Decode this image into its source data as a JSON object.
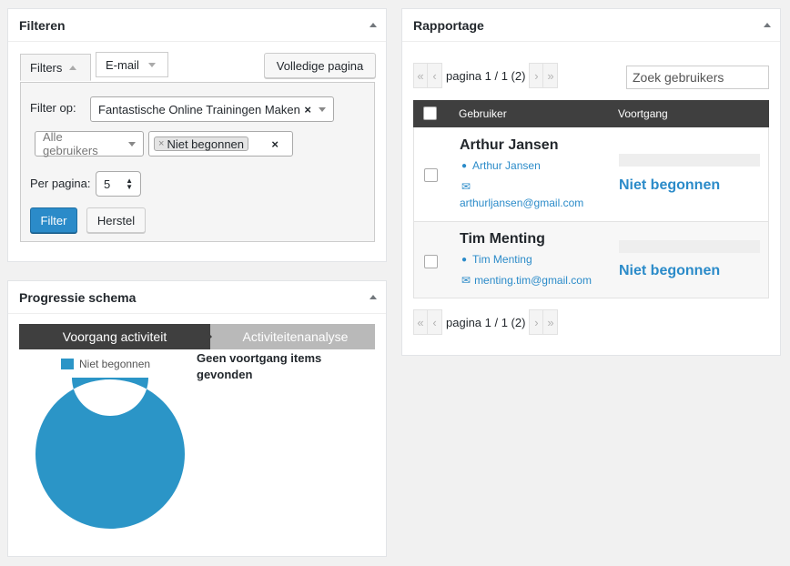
{
  "filter_box": {
    "title": "Filteren",
    "tab_filters": "Filters",
    "tab_email": "E-mail",
    "full_page_button": "Volledige pagina",
    "filter_on_label": "Filter op:",
    "course_select": "Fantastische Online Trainingen Maken",
    "users_select": "Alle gebruikers",
    "status_tag": "Niet begonnen",
    "per_page_label": "Per pagina:",
    "per_page_value": "5",
    "filter_button": "Filter",
    "reset_button": "Herstel"
  },
  "progress_box": {
    "title": "Progressie schema",
    "step_active": "Voorgang activiteit",
    "step_next": "Activiteitenanalyse",
    "legend_label": "Niet begonnen",
    "no_items_text": "Geen voortgang items gevonden",
    "accent_color": "#2b95c7"
  },
  "chart_data": {
    "type": "pie",
    "categories": [
      "Niet begonnen"
    ],
    "values": [
      100
    ],
    "donut": true
  },
  "report_box": {
    "title": "Rapportage",
    "pagination_text": "pagina 1 / 1 (2)",
    "search_placeholder": "Zoek gebruikers",
    "col_user": "Gebruiker",
    "col_progress": "Voortgang",
    "rows": [
      {
        "name": "Arthur Jansen",
        "username": "Arthur Jansen",
        "email": "arthurljansen@gmail.com",
        "status": "Niet begonnen",
        "progress": 0
      },
      {
        "name": "Tim Menting",
        "username": "Tim Menting",
        "email": "menting.tim@gmail.com",
        "status": "Niet begonnen",
        "progress": 0
      }
    ]
  }
}
